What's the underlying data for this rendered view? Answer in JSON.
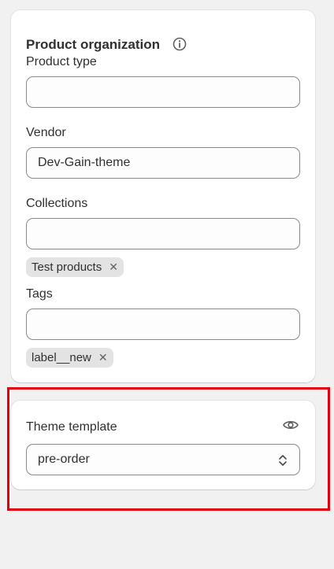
{
  "product_organization": {
    "title": "Product organization",
    "info_icon": "info-icon",
    "product_type": {
      "label": "Product type",
      "value": ""
    },
    "vendor": {
      "label": "Vendor",
      "value": "Dev-Gain-theme"
    },
    "collections": {
      "label": "Collections",
      "value": "",
      "tags": [
        "Test products"
      ]
    },
    "tags": {
      "label": "Tags",
      "value": "",
      "tags": [
        "label__new"
      ]
    }
  },
  "theme_template": {
    "label": "Theme template",
    "preview_icon": "eye-icon",
    "selected": "pre-order",
    "select_icon": "select-arrows-icon"
  },
  "highlight_color": "#e1000f"
}
